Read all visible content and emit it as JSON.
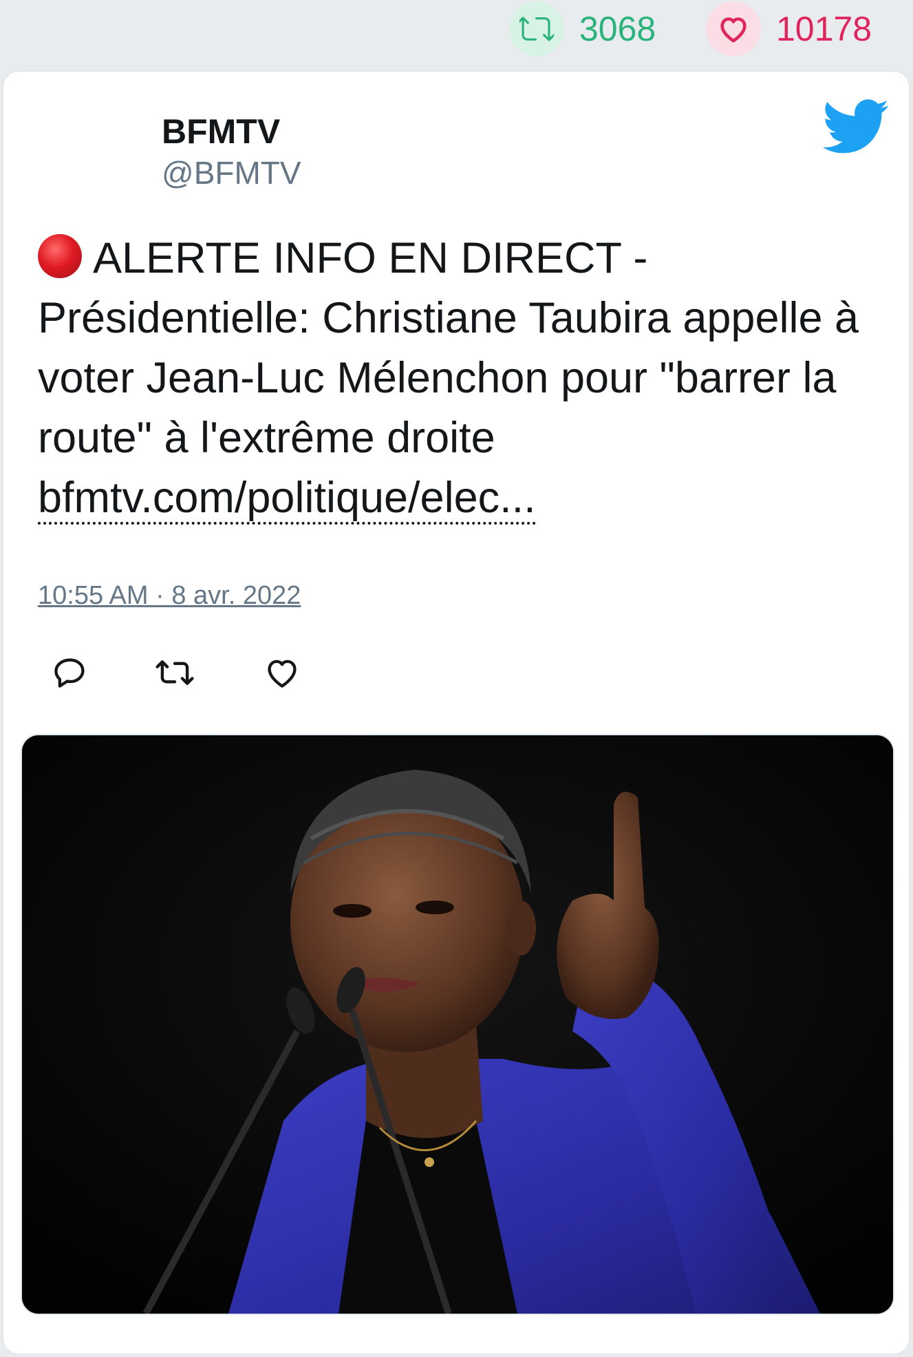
{
  "stats": {
    "retweets": "3068",
    "likes": "10178",
    "retweet_icon": "retweet-icon",
    "like_icon": "heart-icon",
    "retweet_color": "#2ab37a",
    "like_color": "#e0245e"
  },
  "tweet": {
    "author_name": "BFMTV",
    "author_handle": "@BFMTV",
    "platform_icon": "twitter-bird-icon",
    "alert_icon": "red-circle-icon",
    "text": "ALERTE INFO EN DIRECT - Présidentielle: Christiane Taubira appelle à voter Jean-Luc Mélenchon pour \"barrer la route\" à l'extrême droite",
    "link": "bfmtv.com/politique/elec...",
    "timestamp": "10:55 AM · 8 avr. 2022",
    "actions": [
      "reply-icon",
      "retweet-icon",
      "like-icon"
    ],
    "accent_color": "#1da1f2"
  }
}
